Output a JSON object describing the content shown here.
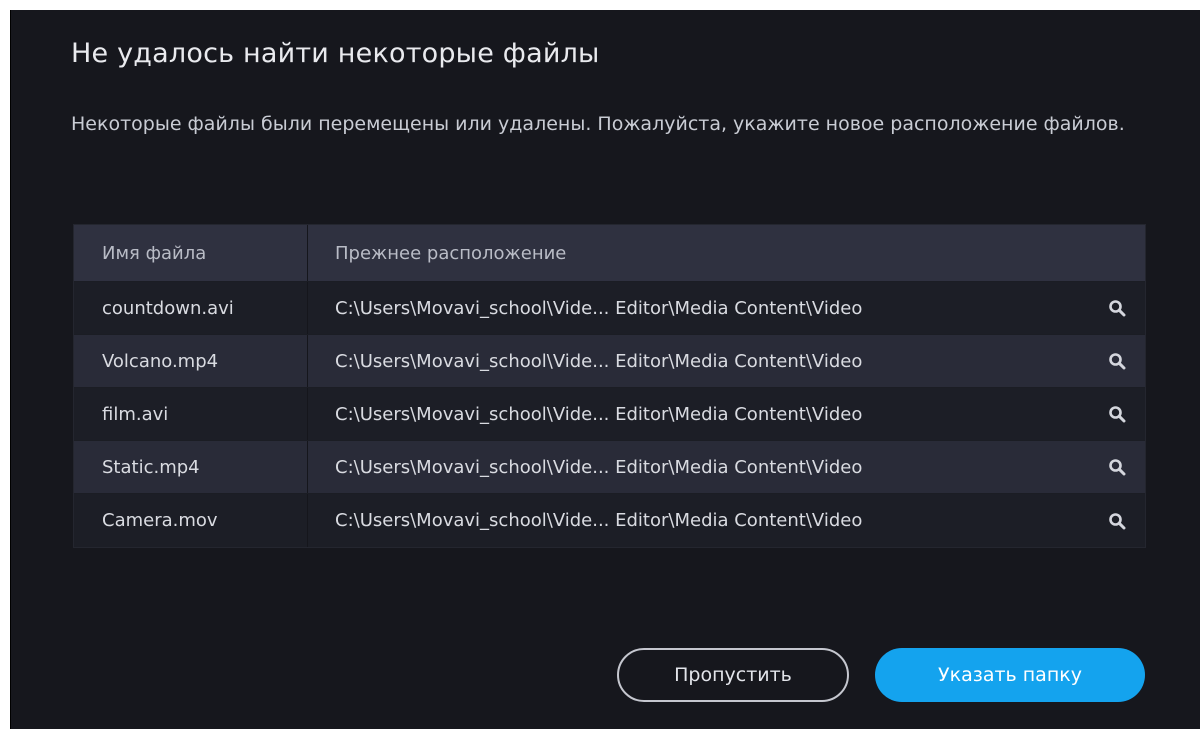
{
  "dialog": {
    "title": "Не удалось найти некоторые файлы",
    "message": "Некоторые файлы были перемещены или удалены. Пожалуйста, укажите новое расположение файлов."
  },
  "table": {
    "columns": [
      "Имя файла",
      "Прежнее расположение"
    ],
    "rows": [
      {
        "name": "countdown.avi",
        "path": "C:\\Users\\Movavi_school\\Vide... Editor\\Media Content\\Video"
      },
      {
        "name": "Volcano.mp4",
        "path": "C:\\Users\\Movavi_school\\Vide... Editor\\Media Content\\Video"
      },
      {
        "name": "film.avi",
        "path": "C:\\Users\\Movavi_school\\Vide... Editor\\Media Content\\Video"
      },
      {
        "name": "Static.mp4",
        "path": "C:\\Users\\Movavi_school\\Vide... Editor\\Media Content\\Video"
      },
      {
        "name": "Camera.mov",
        "path": "C:\\Users\\Movavi_school\\Vide... Editor\\Media Content\\Video"
      }
    ],
    "row_icon": "search-icon"
  },
  "buttons": {
    "skip_label": "Пропустить",
    "choose_folder_label": "Указать папку"
  },
  "colors": {
    "background": "#16171d",
    "header_row": "#2f3140",
    "row_odd": "#1c1e26",
    "row_even": "#292b38",
    "accent": "#14a3ee"
  }
}
